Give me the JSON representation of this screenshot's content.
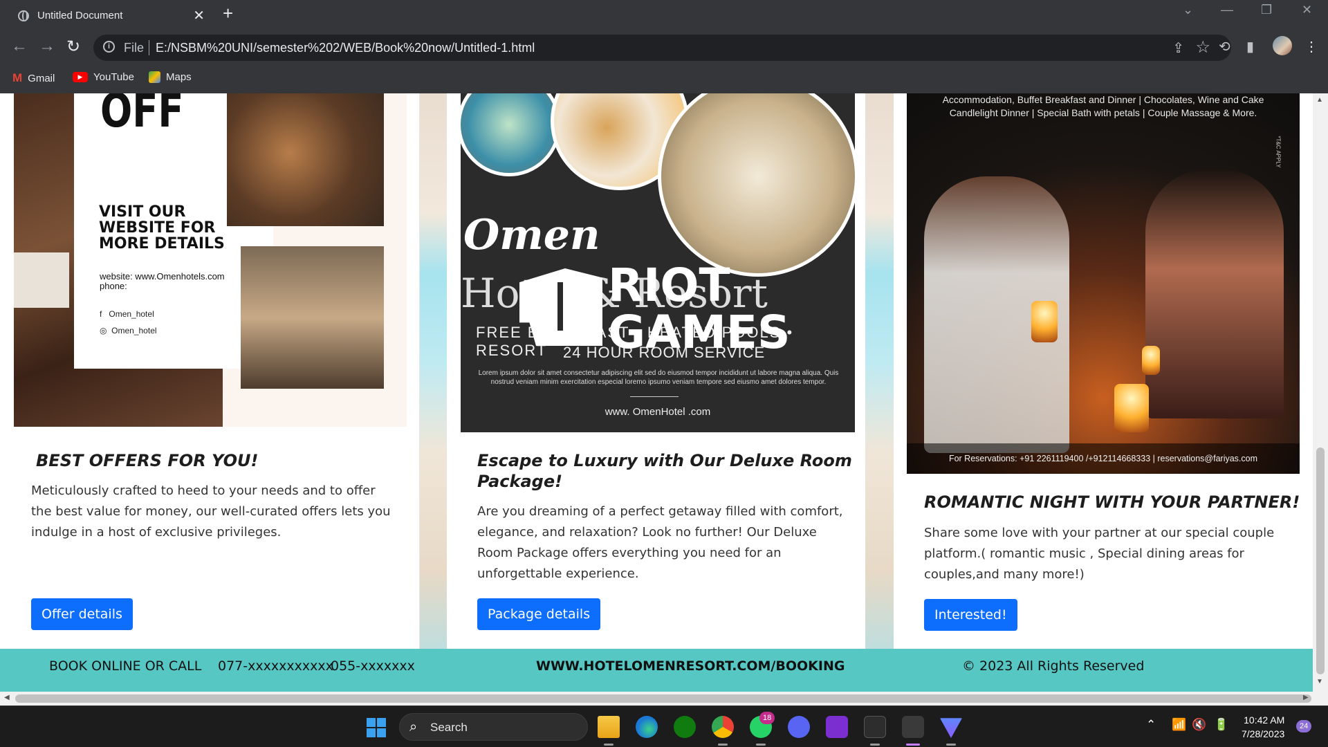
{
  "browser": {
    "tab_title": "Untitled Document",
    "tab_close": "✕",
    "new_tab": "+",
    "window_controls": [
      "⌄",
      "—",
      "❐",
      "✕"
    ],
    "url_scheme_label": "File",
    "url": "E:/NSBM%20UNI/semester%202/WEB/Book%20now/Untitled-1.html",
    "nav": {
      "back": "←",
      "forward": "→",
      "reload": "↻"
    },
    "bookmarks": [
      {
        "label": "Gmail",
        "icon": "gmail-icon"
      },
      {
        "label": "YouTube",
        "icon": "youtube-icon"
      },
      {
        "label": "Maps",
        "icon": "maps-icon"
      }
    ]
  },
  "cards": [
    {
      "poster": {
        "off": "OFF",
        "visit_line1": "VISIT OUR",
        "visit_line2": "WEBSITE FOR",
        "visit_line3": "MORE DETAILS",
        "website": "website: www.Omenhotels.com",
        "phone": "phone:",
        "facebook": "Omen_hotel",
        "instagram": "Omen_hotel"
      },
      "title": "BEST OFFERS FOR YOU!",
      "text_line1": "Meticulously crafted to heed to your needs and to offer",
      "text_line2": "the best value for money, our well-curated offers lets you",
      "text_line3": "indulge in a host of exclusive privileges.",
      "button": "Offer details"
    },
    {
      "poster": {
        "brand": "Omen",
        "hotel": "Hotel & Resort",
        "free": "FREE BREAKFAST • HEATED POOLS • RESORT",
        "room": "24 HOUR ROOM SERVICE",
        "lorem": "Lorem ipsum dolor sit amet consectetur adipiscing elit sed do eiusmod tempor incididunt ut labore magna aliqua. Quis nostrud veniam minim exercitation especial loremo ipsumo veniam tempore sed eiusmo amet dolores tempor.",
        "www": "www. OmenHotel .com",
        "overlay_line1": "RIOT",
        "overlay_line2": "GAMES"
      },
      "title_line1": "Escape to Luxury with Our Deluxe Room",
      "title_line2": "Package!",
      "text_line1": "Are you dreaming of a perfect getaway filled with comfort,",
      "text_line2": "elegance, and relaxation? Look no further! Our Deluxe",
      "text_line3": "Room Package offers everything you need for an",
      "text_line4": "unforgettable experience.",
      "button": "Package details"
    },
    {
      "poster": {
        "top_line1": "Accommodation, Buffet Breakfast and Dinner  | Chocolates, Wine and Cake",
        "top_line2": "Candlelight Dinner | Special Bath with petals | Couple Massage & More.",
        "reservations": "For Reservations: +91 2261119400 /+912114668333 | reservations@fariyas.com",
        "tc": "*T&C APPLY"
      },
      "title": "ROMANTIC NIGHT WITH YOUR PARTNER!",
      "text_line1": "Share some love with your partner at our special couple",
      "text_line2": "platform.( romantic music , Special dining areas for",
      "text_line3": "couples,and many more!)",
      "button": "Interested!"
    }
  ],
  "footer": {
    "book": "BOOK ONLINE OR CALL",
    "phone1": "077-xxxxxxxxxxx",
    "phone2": "055-xxxxxxx",
    "site": "WWW.HOTELOMENRESORT.COM/BOOKING",
    "copyright": "© 2023 All Rights Reserved"
  },
  "taskbar": {
    "search": "Search",
    "whatsapp_badge": "18",
    "notification_badge": "24",
    "time": "10:42 AM",
    "date": "7/28/2023",
    "tray_icons": [
      "chevron-up-icon",
      "wifi-icon",
      "speaker-muted-icon",
      "battery-icon"
    ]
  },
  "colors": {
    "chrome_bg": "#35363a",
    "button_blue": "#0d6efd",
    "footer_teal": "#56c7c3",
    "taskbar_bg": "#1c1c1c"
  }
}
